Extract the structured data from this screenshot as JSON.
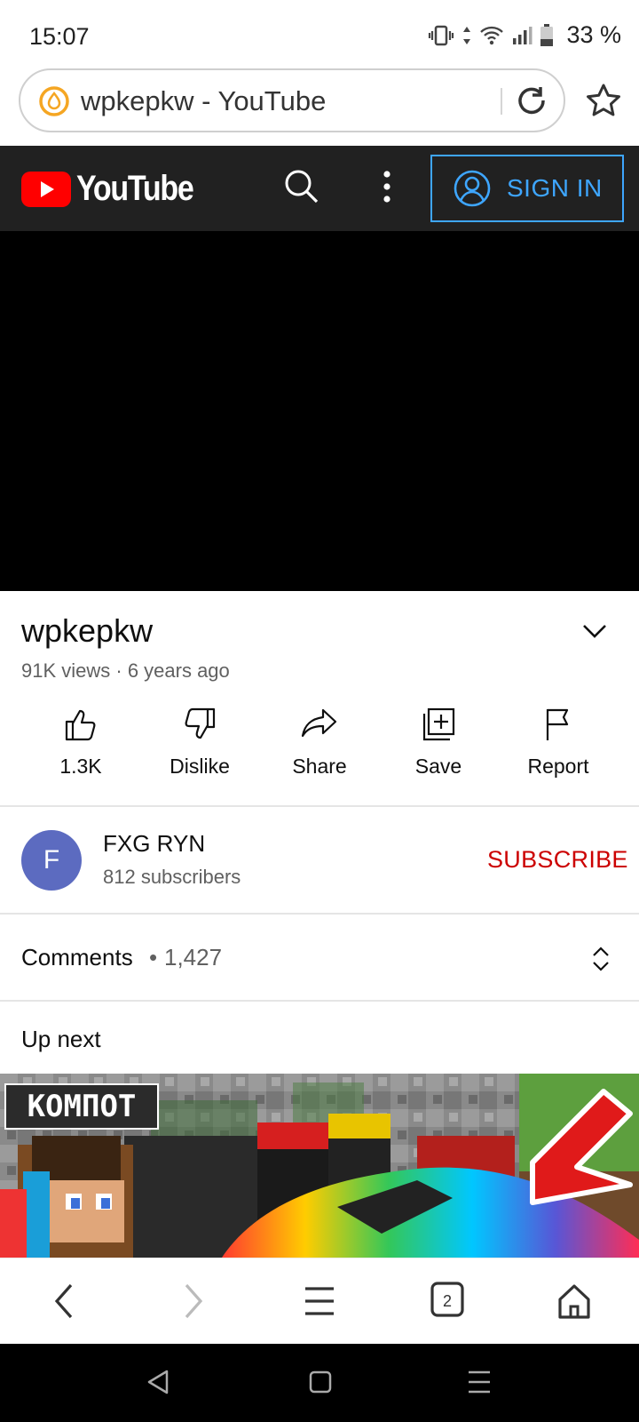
{
  "status_bar": {
    "time": "15:07",
    "battery": "33 %"
  },
  "browser": {
    "url_text": "wpkepkw - YouTube",
    "tab_count": "2"
  },
  "youtube": {
    "logo_text": "YouTube",
    "sign_in_label": "SIGN IN"
  },
  "video": {
    "title": "wpkepkw",
    "meta": "91K views · 6 years ago",
    "actions": [
      {
        "label": "1.3K",
        "icon": "like-icon"
      },
      {
        "label": "Dislike",
        "icon": "dislike-icon"
      },
      {
        "label": "Share",
        "icon": "share-icon"
      },
      {
        "label": "Save",
        "icon": "save-to-playlist-icon"
      },
      {
        "label": "Report",
        "icon": "flag-icon"
      }
    ]
  },
  "channel": {
    "avatar_letter": "F",
    "name": "FXG RYN",
    "subscribers": "812 subscribers",
    "subscribe_label": "SUBSCRIBE"
  },
  "comments": {
    "label": "Comments",
    "separator": "•",
    "count": "1,427"
  },
  "up_next": {
    "label": "Up next",
    "thumbnail_badge": "KOMПOT"
  },
  "colors": {
    "yt_header_bg": "#212121",
    "sign_in_blue": "#3ea6ff",
    "subscribe_red": "#cc0000",
    "avatar_bg": "#5c6bc0"
  }
}
